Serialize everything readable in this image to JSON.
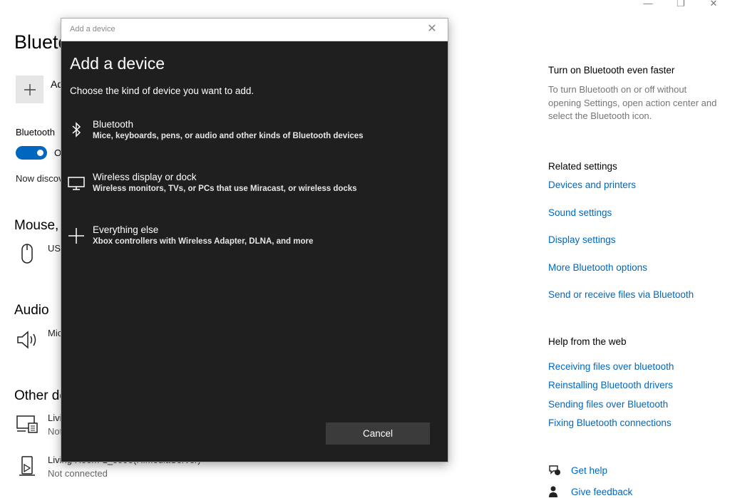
{
  "window_controls": {
    "minimize": "—",
    "restore": "❐",
    "close": "✕"
  },
  "settings": {
    "page_title": "Bluetooth & other devices",
    "add_label": "Add Bluetooth or other device",
    "bluetooth_label": "Bluetooth",
    "toggle_state": "On",
    "discoverable_text": "Now discoverable as",
    "sections": {
      "mouse": "Mouse, keyboard, & pen",
      "audio": "Audio",
      "other": "Other devices"
    },
    "devices": [
      {
        "name": "USB Optical Mouse",
        "status": ""
      },
      {
        "name": "Microphone",
        "status": ""
      },
      {
        "name": "Living Room",
        "status": "Not connected"
      },
      {
        "name": "Living Room-1_5995(HiMediaServer)",
        "status": "Not connected"
      }
    ]
  },
  "right_panel": {
    "faster_heading": "Turn on Bluetooth even faster",
    "faster_text": "To turn Bluetooth on or off without opening Settings, open action center and select the Bluetooth icon.",
    "related_heading": "Related settings",
    "related_links": [
      "Devices and printers",
      "Sound settings",
      "Display settings",
      "More Bluetooth options",
      "Send or receive files via Bluetooth"
    ],
    "help_heading": "Help from the web",
    "help_links": [
      "Receiving files over bluetooth",
      "Reinstalling Bluetooth drivers",
      "Sending files over Bluetooth",
      "Fixing Bluetooth connections"
    ],
    "get_help": "Get help",
    "give_feedback": "Give feedback"
  },
  "dialog": {
    "titlebar": "Add a device",
    "heading": "Add a device",
    "subtitle": "Choose the kind of device you want to add.",
    "options": [
      {
        "icon": "bluetooth-icon",
        "title": "Bluetooth",
        "desc": "Mice, keyboards, pens, or audio and other kinds of Bluetooth devices"
      },
      {
        "icon": "monitor-icon",
        "title": "Wireless display or dock",
        "desc": "Wireless monitors, TVs, or PCs that use Miracast, or wireless docks"
      },
      {
        "icon": "plus-icon",
        "title": "Everything else",
        "desc": "Xbox controllers with Wireless Adapter, DLNA, and more"
      }
    ],
    "cancel": "Cancel"
  }
}
